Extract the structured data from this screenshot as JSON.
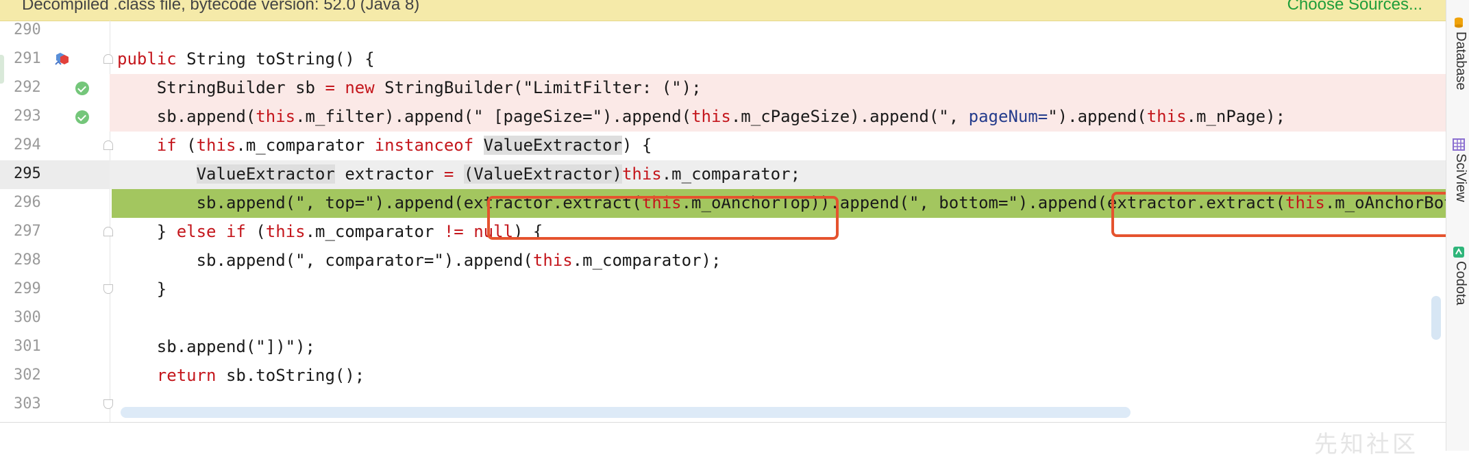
{
  "banner": {
    "text": "Decompiled .class file, bytecode version: 52.0 (Java 8)",
    "link": "Choose Sources..."
  },
  "lines": [
    {
      "n": "290"
    },
    {
      "n": "291",
      "kw1": "public",
      "rest1": " String toString() {"
    },
    {
      "n": "292",
      "p1": "    StringBuilder sb ",
      "op": "=",
      "sp": " ",
      "kw": "new",
      "p2": " StringBuilder(\"LimitFilter: (\");"
    },
    {
      "n": "293",
      "p1": "    sb.append(",
      "this1": "this",
      "p2": ".m_filter).append(\" [pageSize=\").append(",
      "this2": "this",
      "p3": ".m_cPageSize).append(\", ",
      "named": "pageNum=",
      "p4": "\").append(",
      "this3": "this",
      "p5": ".m_nPage);"
    },
    {
      "n": "294",
      "p1": "    ",
      "kw_if": "if",
      "p2": " (",
      "this1": "this",
      "p3": ".m_comparator ",
      "kw_inst": "instanceof",
      "sp": " ",
      "hl": "ValueExtractor",
      "p4": ") {"
    },
    {
      "n": "295",
      "p0": "        ",
      "hl1": "ValueExtractor",
      "p1": " extractor ",
      "op": "=",
      "sp": " ",
      "hl2": "(ValueExtractor)",
      "this1": "this",
      "p2": ".m_comparator;"
    },
    {
      "n": "296",
      "p1": "        sb.append(\", top=\").append(extractor.extract(",
      "this1": "this",
      "p2": ".m_oAnchorTop)).append(\", bottom=\").append(extractor.extract(",
      "this2": "this",
      "p3": ".m_oAnchorBottom"
    },
    {
      "n": "297",
      "p1": "    } ",
      "kw_else": "else",
      "sp": " ",
      "kw_if": "if",
      "p2": " (",
      "this1": "this",
      "p3": ".m_comparator ",
      "op": "!=",
      "sp2": " ",
      "kw_null": "null",
      "p4": ") {"
    },
    {
      "n": "298",
      "p1": "        sb.append(\", comparator=\").append(",
      "this1": "this",
      "p2": ".m_comparator);"
    },
    {
      "n": "299",
      "p1": "    }"
    },
    {
      "n": "300"
    },
    {
      "n": "301",
      "p1": "    sb.append(\"])\");"
    },
    {
      "n": "302",
      "p1": "    ",
      "kw_ret": "return",
      "p2": " sb.toString();"
    },
    {
      "n": "303"
    }
  ],
  "right_tools": [
    {
      "label": "Database",
      "icon": "database-icon"
    },
    {
      "label": "SciView",
      "icon": "grid-icon"
    },
    {
      "label": "Codota",
      "icon": "codota-icon"
    }
  ],
  "watermark": "先知社区",
  "colors": {
    "banner_bg": "#f5eaa9",
    "exec_line": "#a3c65f",
    "deleted_line": "#fbe9e7",
    "keyword": "#c4161c",
    "highlight_box": "#e5532e"
  }
}
